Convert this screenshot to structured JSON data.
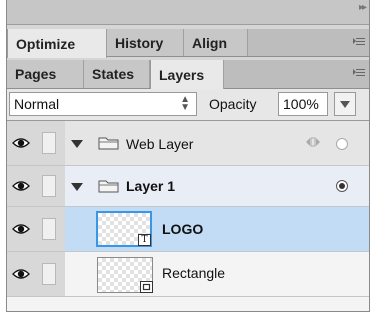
{
  "panel_group_top": {
    "tabs": [
      {
        "label": "Optimize",
        "active": true
      },
      {
        "label": "History",
        "active": false
      },
      {
        "label": "Align",
        "active": false
      }
    ]
  },
  "panel_group_layers": {
    "tabs": [
      {
        "label": "Pages",
        "active": false
      },
      {
        "label": "States",
        "active": false
      },
      {
        "label": "Layers",
        "active": true
      }
    ]
  },
  "options": {
    "blend_mode": "Normal",
    "opacity_label": "Opacity",
    "opacity_value": "100%"
  },
  "layers": [
    {
      "name": "Web Layer",
      "type": "folder",
      "visible": true,
      "expanded": true,
      "selected": false
    },
    {
      "name": "Layer 1",
      "type": "folder",
      "visible": true,
      "expanded": true,
      "selected": false
    },
    {
      "name": "LOGO",
      "type": "text",
      "visible": true,
      "selected": true,
      "badge": "T"
    },
    {
      "name": "Rectangle",
      "type": "shape",
      "visible": true,
      "selected": false
    }
  ],
  "colors": {
    "selected_row": "#c3dcf5",
    "thumb_selected_border": "#3a97e8"
  }
}
